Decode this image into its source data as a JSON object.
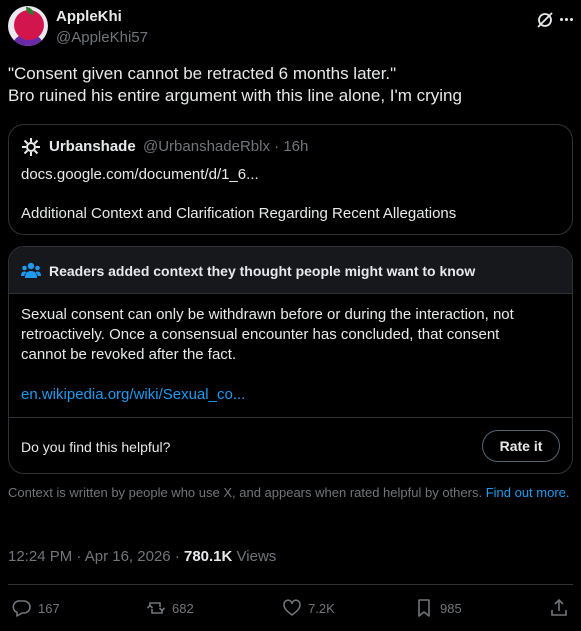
{
  "author": {
    "display_name": "AppleKhi",
    "handle": "@AppleKhi57"
  },
  "tweet": {
    "lines": [
      "\"Consent given cannot be retracted 6 months later.\"",
      "Bro ruined his entire argument with this line alone, I'm crying"
    ]
  },
  "quote": {
    "name": "Urbanshade",
    "handle": "@UrbanshadeRblx",
    "separator": "·",
    "time": "16h",
    "link": "docs.google.com/document/d/1_6...",
    "body": "Additional Context and Clarification Regarding Recent Allegations"
  },
  "community_note": {
    "title": "Readers added context they thought people might want to know",
    "lines": [
      "Sexual consent can only be withdrawn before or during the interaction, not",
      "retroactively. Once a consensual encounter has concluded, that consent",
      "cannot be revoked after the fact."
    ],
    "link": "en.wikipedia.org/wiki/Sexual_co...",
    "helpful_prompt": "Do you find this helpful?",
    "rate_label": "Rate it"
  },
  "context_note": {
    "text": "Context is written by people who use X, and appears when rated helpful by others.",
    "link_label": "Find out more."
  },
  "meta": {
    "time": "12:24 PM",
    "date": "Apr 16, 2026",
    "separator": "·",
    "views_count": "780.1K",
    "views_label": "Views"
  },
  "actions": {
    "replies": "167",
    "reposts": "682",
    "likes": "7.2K",
    "bookmarks": "985"
  },
  "colors": {
    "background": "#000000",
    "text": "#e7e9ea",
    "muted": "#71767b",
    "border": "#2f3336",
    "accent": "#1d9bf0",
    "note_header": "#16181c"
  },
  "icons": [
    "grok-icon",
    "more-icon",
    "community-notes-icon",
    "reply-icon",
    "repost-icon",
    "like-icon",
    "bookmark-icon",
    "share-icon"
  ]
}
